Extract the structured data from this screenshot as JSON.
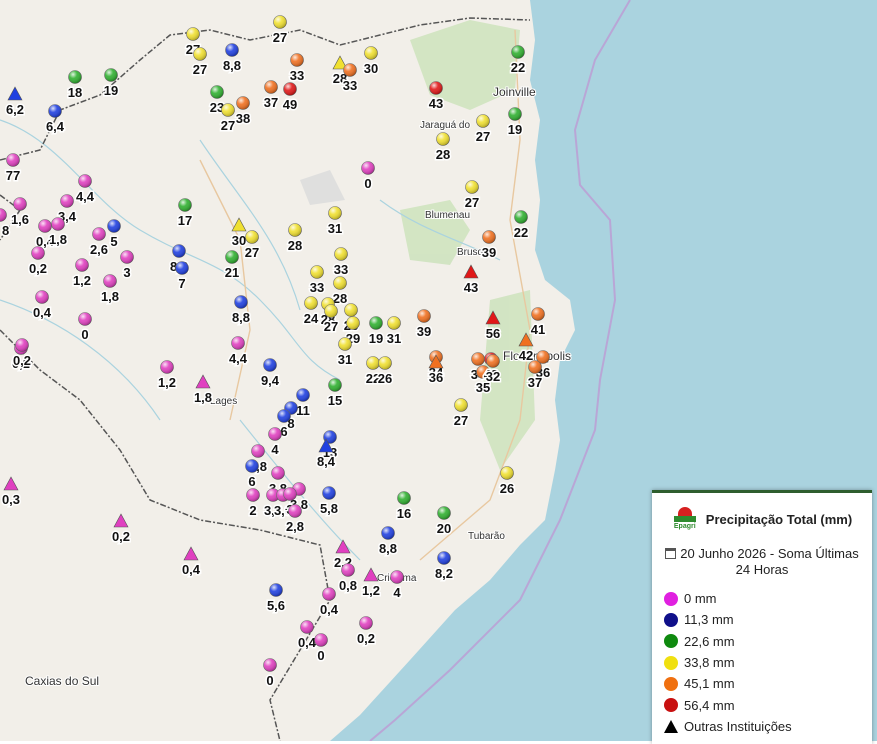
{
  "map": {
    "cities": [
      {
        "name": "Joinville",
        "small": false
      },
      {
        "name": "Jaraguá do",
        "small": true
      },
      {
        "name": "Blumenau",
        "small": true
      },
      {
        "name": "Brusque",
        "small": true
      },
      {
        "name": "Florianópolis",
        "small": false
      },
      {
        "name": "Tubarão",
        "small": true
      },
      {
        "name": "Criciúma",
        "small": true
      },
      {
        "name": "Caxias do Sul",
        "small": false
      },
      {
        "name": "Lages",
        "small": true
      }
    ]
  },
  "legend": {
    "title": "Precipitação Total (mm)",
    "logo_text": "Epagri",
    "date_text": "20 Junho 2026 - Soma Últimas 24 Horas",
    "calendar_icon": "calendar-icon",
    "items": [
      {
        "label": "0 mm",
        "color": "#e020e0"
      },
      {
        "label": "11,3 mm",
        "color": "#10108a"
      },
      {
        "label": "22,6 mm",
        "color": "#0f8a0f"
      },
      {
        "label": "33,8 mm",
        "color": "#f0e010"
      },
      {
        "label": "45,1 mm",
        "color": "#f07010"
      },
      {
        "label": "56,4 mm",
        "color": "#c81010"
      }
    ],
    "other_label": "Outras Instituições"
  },
  "stations": [
    {
      "v": "27",
      "c": "yellow",
      "s": "c"
    },
    {
      "v": "27",
      "c": "yellow",
      "s": "c"
    },
    {
      "v": "27",
      "c": "yellow",
      "s": "c"
    },
    {
      "v": "8,8",
      "c": "blue",
      "s": "c"
    },
    {
      "v": "33",
      "c": "orange",
      "s": "c"
    },
    {
      "v": "28",
      "c": "yellow",
      "s": "t"
    },
    {
      "v": "33",
      "c": "orange",
      "s": "c"
    },
    {
      "v": "30",
      "c": "yellow",
      "s": "c"
    },
    {
      "v": "18",
      "c": "green",
      "s": "c"
    },
    {
      "v": "19",
      "c": "green",
      "s": "c"
    },
    {
      "v": "23",
      "c": "green",
      "s": "c"
    },
    {
      "v": "37",
      "c": "orange",
      "s": "c"
    },
    {
      "v": "49",
      "c": "red",
      "s": "c"
    },
    {
      "v": "38",
      "c": "orange",
      "s": "c"
    },
    {
      "v": "27",
      "c": "yellow",
      "s": "c"
    },
    {
      "v": "22",
      "c": "green",
      "s": "c"
    },
    {
      "v": "6,2",
      "c": "blue",
      "s": "t"
    },
    {
      "v": "6,4",
      "c": "blue",
      "s": "c"
    },
    {
      "v": "43",
      "c": "red",
      "s": "c"
    },
    {
      "v": "19",
      "c": "green",
      "s": "c"
    },
    {
      "v": "27",
      "c": "yellow",
      "s": "c"
    },
    {
      "v": "28",
      "c": "yellow",
      "s": "c"
    },
    {
      "v": "0",
      "c": "pink",
      "s": "c"
    },
    {
      "v": "4,4",
      "c": "pink",
      "s": "c"
    },
    {
      "v": "3,4",
      "c": "pink",
      "s": "c"
    },
    {
      "v": "1,6",
      "c": "pink",
      "s": "c"
    },
    {
      "v": "0,4",
      "c": "pink",
      "s": "c"
    },
    {
      "v": "1,8",
      "c": "pink",
      "s": "c"
    },
    {
      "v": "5",
      "c": "blue",
      "s": "c"
    },
    {
      "v": "2,6",
      "c": "pink",
      "s": "c"
    },
    {
      "v": "3",
      "c": "pink",
      "s": "c"
    },
    {
      "v": "0,2",
      "c": "pink",
      "s": "c"
    },
    {
      "v": "1,2",
      "c": "pink",
      "s": "c"
    },
    {
      "v": "1,8",
      "c": "pink",
      "s": "c"
    },
    {
      "v": "17",
      "c": "green",
      "s": "c"
    },
    {
      "v": "30",
      "c": "yellow",
      "s": "t"
    },
    {
      "v": "27",
      "c": "yellow",
      "s": "c"
    },
    {
      "v": "28",
      "c": "yellow",
      "s": "c"
    },
    {
      "v": "31",
      "c": "yellow",
      "s": "c"
    },
    {
      "v": "27",
      "c": "yellow",
      "s": "c"
    },
    {
      "v": "33",
      "c": "yellow",
      "s": "c"
    },
    {
      "v": "22",
      "c": "green",
      "s": "c"
    },
    {
      "v": "39",
      "c": "orange",
      "s": "c"
    },
    {
      "v": "8,2",
      "c": "blue",
      "s": "c"
    },
    {
      "v": "7",
      "c": "blue",
      "s": "c"
    },
    {
      "v": "21",
      "c": "green",
      "s": "c"
    },
    {
      "v": "33",
      "c": "yellow",
      "s": "c"
    },
    {
      "v": "43",
      "c": "red",
      "s": "t"
    },
    {
      "v": "24",
      "c": "yellow",
      "s": "c"
    },
    {
      "v": "28",
      "c": "yellow",
      "s": "c"
    },
    {
      "v": "0,4",
      "c": "pink",
      "s": "c"
    },
    {
      "v": "0",
      "c": "pink",
      "s": "c"
    },
    {
      "v": "8,8",
      "c": "blue",
      "s": "c"
    },
    {
      "v": "28",
      "c": "yellow",
      "s": "c"
    },
    {
      "v": "26",
      "c": "yellow",
      "s": "c"
    },
    {
      "v": "27",
      "c": "yellow",
      "s": "c"
    },
    {
      "v": "29",
      "c": "yellow",
      "s": "c"
    },
    {
      "v": "19",
      "c": "green",
      "s": "c"
    },
    {
      "v": "31",
      "c": "yellow",
      "s": "c"
    },
    {
      "v": "39",
      "c": "orange",
      "s": "c"
    },
    {
      "v": "56",
      "c": "red",
      "s": "t"
    },
    {
      "v": "41",
      "c": "orange",
      "s": "c"
    },
    {
      "v": "42",
      "c": "orange",
      "s": "t"
    },
    {
      "v": "0,2",
      "c": "pink",
      "s": "c"
    },
    {
      "v": "4,4",
      "c": "pink",
      "s": "c"
    },
    {
      "v": "31",
      "c": "yellow",
      "s": "c"
    },
    {
      "v": "34",
      "c": "orange",
      "s": "c"
    },
    {
      "v": "36",
      "c": "orange",
      "s": "c"
    },
    {
      "v": "1,2",
      "c": "pink",
      "s": "c"
    },
    {
      "v": "1,8",
      "c": "pink",
      "s": "t"
    },
    {
      "v": "9,4",
      "c": "blue",
      "s": "c"
    },
    {
      "v": "22",
      "c": "yellow",
      "s": "c"
    },
    {
      "v": "26",
      "c": "yellow",
      "s": "c"
    },
    {
      "v": "36",
      "c": "orange",
      "s": "t"
    },
    {
      "v": "34",
      "c": "orange",
      "s": "c"
    },
    {
      "v": "35",
      "c": "orange",
      "s": "c"
    },
    {
      "v": "48",
      "c": "red",
      "s": "c"
    },
    {
      "v": "32",
      "c": "orange",
      "s": "c"
    },
    {
      "v": "37",
      "c": "orange",
      "s": "c"
    },
    {
      "v": "15",
      "c": "green",
      "s": "c"
    },
    {
      "v": "11",
      "c": "blue",
      "s": "c"
    },
    {
      "v": "27",
      "c": "yellow",
      "s": "c"
    },
    {
      "v": "8",
      "c": "blue",
      "s": "c"
    },
    {
      "v": "6",
      "c": "blue",
      "s": "c"
    },
    {
      "v": "4",
      "c": "pink",
      "s": "c"
    },
    {
      "v": "13",
      "c": "blue",
      "s": "c"
    },
    {
      "v": "8,4",
      "c": "blue",
      "s": "t"
    },
    {
      "v": "1,8",
      "c": "pink",
      "s": "c"
    },
    {
      "v": "6",
      "c": "blue",
      "s": "c"
    },
    {
      "v": "3,8",
      "c": "pink",
      "s": "c"
    },
    {
      "v": "26",
      "c": "yellow",
      "s": "c"
    },
    {
      "v": "0,3",
      "c": "pink",
      "s": "t"
    },
    {
      "v": "3,8",
      "c": "pink",
      "s": "c"
    },
    {
      "v": "3,3",
      "c": "pink",
      "s": "c"
    },
    {
      "v": "2",
      "c": "pink",
      "s": "c"
    },
    {
      "v": "3,6",
      "c": "pink",
      "s": "c"
    },
    {
      "v": "3",
      "c": "pink",
      "s": "c"
    },
    {
      "v": "5,8",
      "c": "blue",
      "s": "c"
    },
    {
      "v": "2,8",
      "c": "pink",
      "s": "c"
    },
    {
      "v": "16",
      "c": "green",
      "s": "c"
    },
    {
      "v": "20",
      "c": "green",
      "s": "c"
    },
    {
      "v": "0,2",
      "c": "pink",
      "s": "t"
    },
    {
      "v": "8,8",
      "c": "blue",
      "s": "c"
    },
    {
      "v": "0,4",
      "c": "pink",
      "s": "t"
    },
    {
      "v": "2,2",
      "c": "pink",
      "s": "t"
    },
    {
      "v": "8,2",
      "c": "blue",
      "s": "c"
    },
    {
      "v": "0,8",
      "c": "pink",
      "s": "c"
    },
    {
      "v": "1,2",
      "c": "pink",
      "s": "t"
    },
    {
      "v": "4",
      "c": "pink",
      "s": "c"
    },
    {
      "v": "5,6",
      "c": "blue",
      "s": "c"
    },
    {
      "v": "0,4",
      "c": "pink",
      "s": "c"
    },
    {
      "v": "0,4",
      "c": "pink",
      "s": "c"
    },
    {
      "v": "0",
      "c": "pink",
      "s": "c"
    },
    {
      "v": "0,2",
      "c": "pink",
      "s": "c"
    },
    {
      "v": "0",
      "c": "pink",
      "s": "c"
    },
    {
      "v": "77",
      "c": "pink",
      "s": "c"
    },
    {
      "v": "8",
      "c": "pink",
      "s": "c"
    },
    {
      "v": "0,2",
      "c": "pink",
      "s": "c"
    }
  ]
}
